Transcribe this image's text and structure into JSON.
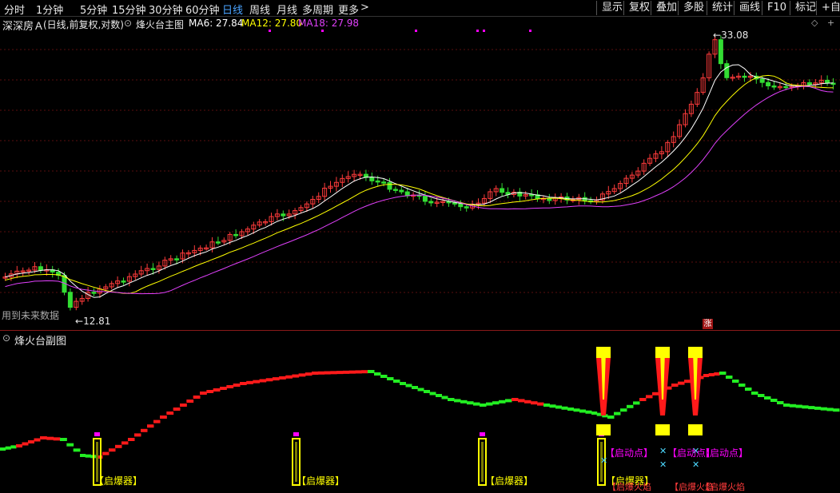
{
  "toolbar": {
    "periods": [
      "分时",
      "1分钟",
      "5分钟",
      "15分钟",
      "30分钟",
      "60分钟",
      "日线",
      "周线",
      "月线",
      "多周期",
      "更多"
    ],
    "more_arrow": ">",
    "right_buttons": [
      "显示",
      "复权",
      "叠加",
      "多股",
      "统计",
      "画线",
      "F10",
      "标记",
      "+自选"
    ]
  },
  "main_chart": {
    "stock_name": "深深房Ａ",
    "mode": "(日线,前复权,对数)",
    "indicator_name": "烽火台主图",
    "ma6": "MA6: 27.84",
    "ma12": "MA12: 27.80",
    "ma18": "MA18: 27.98",
    "high_label": "33.08",
    "low_label": "12.81",
    "future_data_note": "用到未来数据",
    "zhang_badge": "涨"
  },
  "sub_chart": {
    "title": "烽火台副图",
    "detonator_label": "【启爆器】",
    "start_point_label": "【启动点】",
    "flame_label": "【启爆火焰"
  },
  "colors": {
    "up": "#ff3b3b",
    "down": "#33dd33",
    "ma6": "#ffffff",
    "ma12": "#ffff00",
    "ma18": "#e040fb",
    "magenta_text": "#ff00ff",
    "yellow": "#ffff00"
  }
}
